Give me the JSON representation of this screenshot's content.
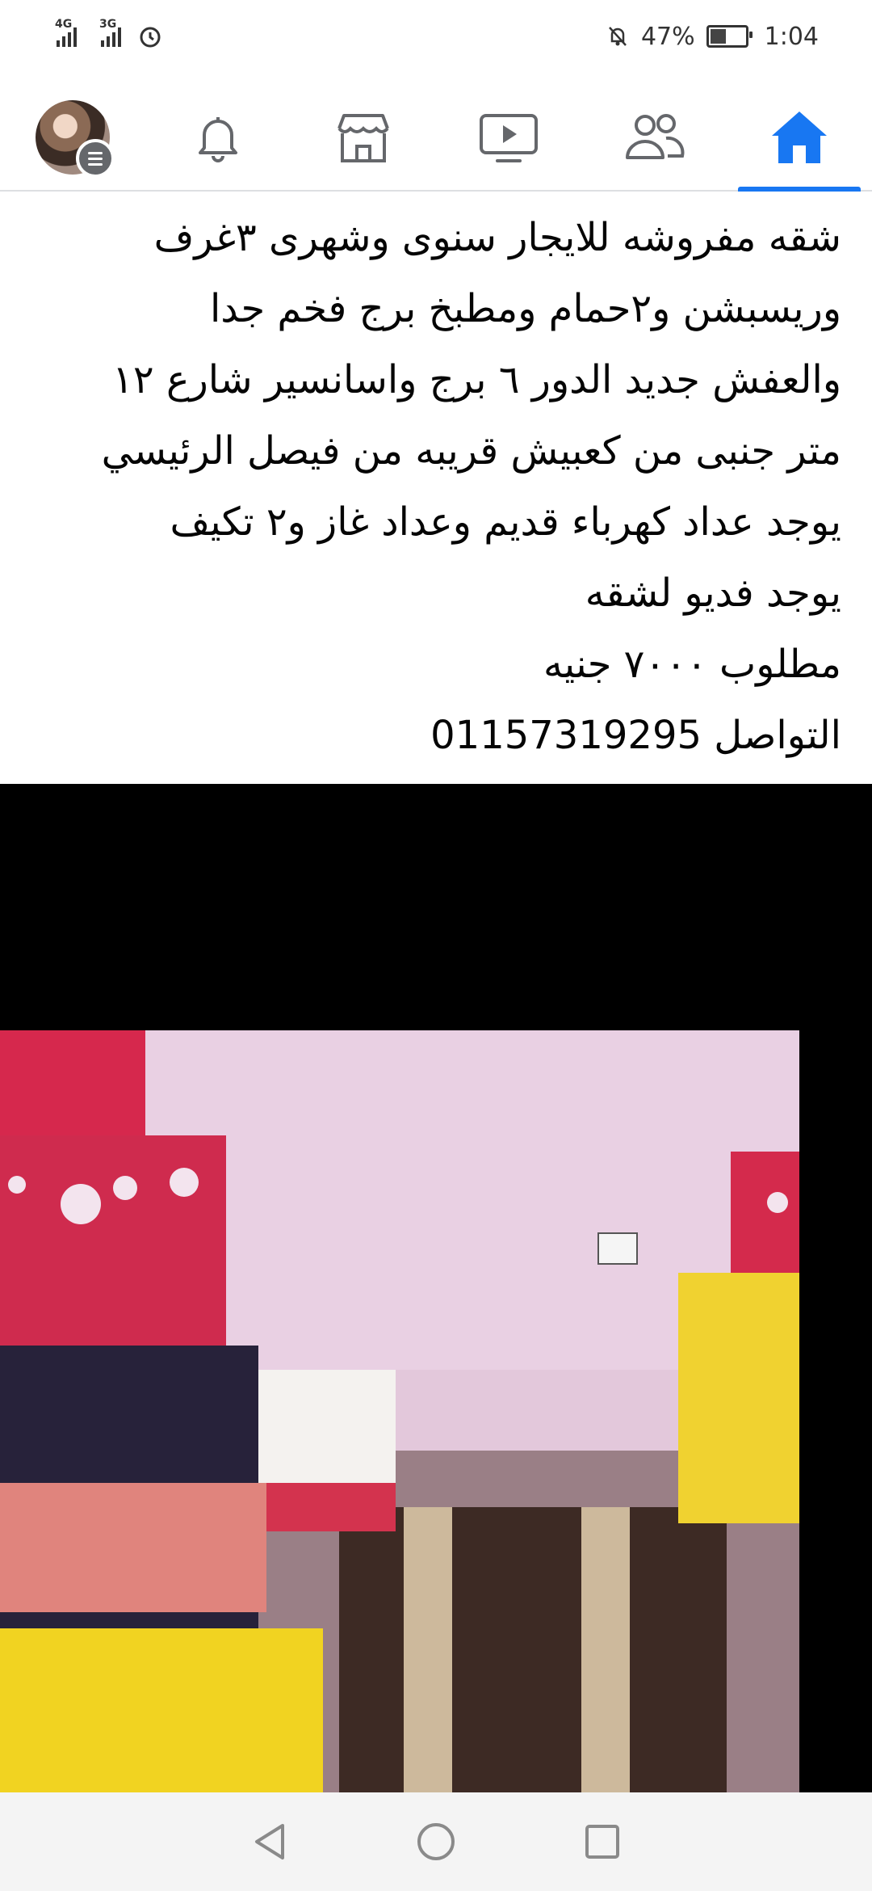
{
  "status_bar": {
    "network_1": "4G",
    "network_2": "3G",
    "battery_level": 0.47,
    "battery_text": "47%",
    "time": "1:04",
    "icons": [
      "alarm-icon",
      "mute-notifications-icon",
      "battery-icon"
    ]
  },
  "nav": {
    "items": [
      {
        "name": "profile-menu",
        "icon": "avatar"
      },
      {
        "name": "notifications",
        "icon": "bell-icon"
      },
      {
        "name": "marketplace",
        "icon": "store-icon"
      },
      {
        "name": "watch",
        "icon": "video-play-icon"
      },
      {
        "name": "groups",
        "icon": "people-icon"
      },
      {
        "name": "home",
        "icon": "home-icon",
        "active": true
      }
    ],
    "accent_color": "#1877f2"
  },
  "post": {
    "lines": [
      "شقه مفروشه للايجار سنوى وشهرى ٣غرف",
      "وريسبشن و٢حمام ومطبخ برج فخم جدا",
      "والعفش جديد الدور ٦ برج واسانسير شارع ١٢",
      "متر جنبى من كعبيش قريبه من فيصل الرئيسي",
      "يوجد عداد كهرباء قديم وعداد غاز و٢ تكيف",
      "يوجد فديو لشقه",
      "مطلوب ٧٠٠٠ جنيه",
      "التواصل 01157319295"
    ],
    "image_description_icon": "bedroom-photo"
  },
  "system_nav": {
    "icons": [
      "back-icon",
      "home-circle-icon",
      "recents-icon"
    ]
  }
}
